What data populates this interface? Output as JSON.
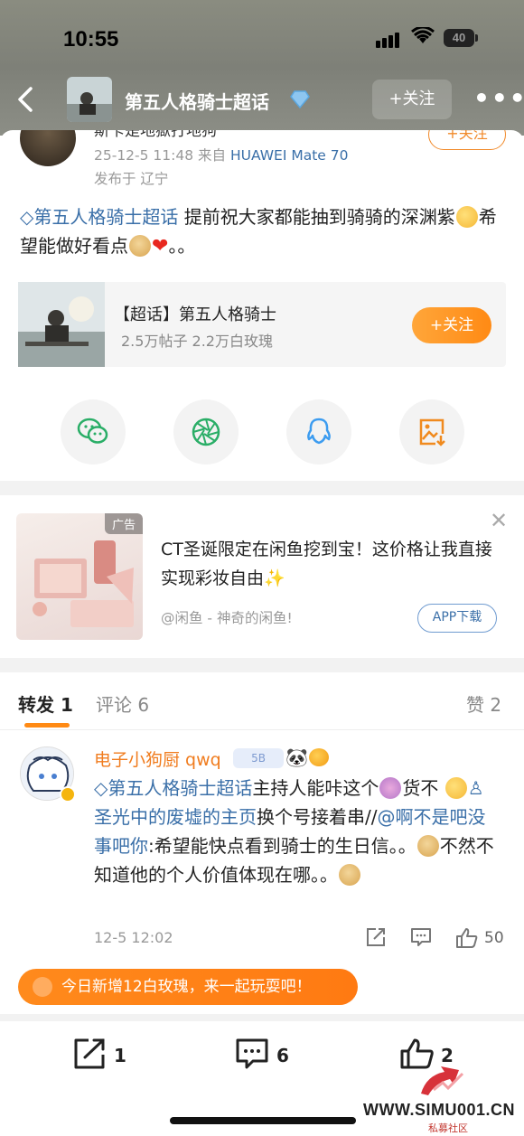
{
  "status": {
    "time": "10:55",
    "battery": "40"
  },
  "header": {
    "title": "第五人格骑士超话",
    "follow": "+关注",
    "more": "•••"
  },
  "post": {
    "cut_name": "斯卡是地獄打地狗",
    "cut_follow": "+关注",
    "meta_time": "25-12-5 11:48  来自",
    "meta_device": "HUAWEI Mate 70",
    "meta_location": "发布于 辽宁",
    "topic_tag": "第五人格骑士超话",
    "text_a": "提前祝大家都能抽到骑骑的深渊紫",
    "text_b": "希望能做好看点",
    "text_c": "。。"
  },
  "topic_card": {
    "title": "【超话】第五人格骑士",
    "stats": "2.5万帖子 2.2万白玫瑰",
    "follow": "+关注"
  },
  "share_icons": [
    "wechat-icon",
    "moments-icon",
    "qq-icon",
    "save-image-icon"
  ],
  "ad": {
    "tag": "广告",
    "text": "CT圣诞限定在闲鱼挖到宝！这价格让我直接实现彩妆自由✨",
    "source": "@闲鱼 - 神奇的闲鱼!",
    "button": "APP下载",
    "close": "✕"
  },
  "tabs": {
    "repost": "转发 1",
    "comments": "评论 6",
    "likes": "赞 2"
  },
  "comment": {
    "name": "电子小狗厨 qwq",
    "level": "5B",
    "topic": "第五人格骑士超话",
    "t1": "主持人能咔这个",
    "t2": "货不",
    "mention1": "圣光中的废墟的主页",
    "t3": "换个号接着串",
    "sep": "//",
    "mention2": "@啊不是吧没事吧你",
    "t4": ":希望能快点看到骑士的生日信。。",
    "t5": "不然不知道他的个人价值体现在哪。。",
    "time": "12-5 12:02",
    "likes": "50"
  },
  "banner": {
    "text": "今日新增12白玫瑰，来一起玩耍吧！"
  },
  "bottom": {
    "repost": "1",
    "comment": "6",
    "like": "2"
  },
  "watermark": {
    "text": "WWW.SIMU001.CN",
    "sub": "私募社区"
  },
  "colors": {
    "accent": "#ff8a14",
    "link": "#3a6fa8"
  }
}
